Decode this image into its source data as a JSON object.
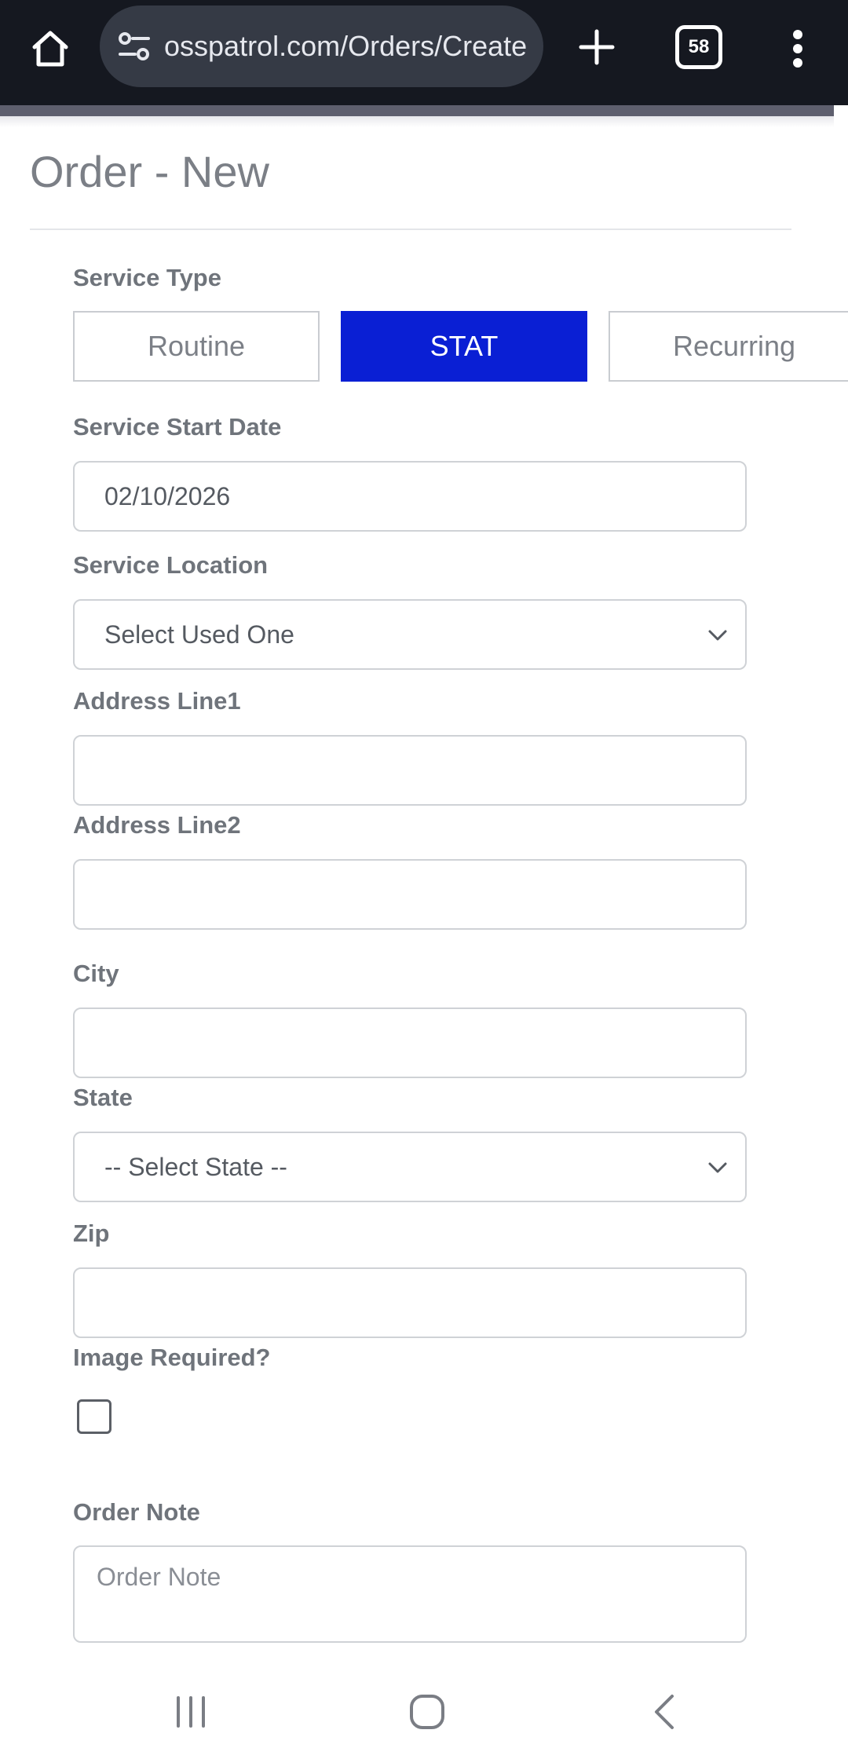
{
  "browser": {
    "url": "osspatrol.com/Orders/Create",
    "tab_count": "58",
    "icons": {
      "home": "home-icon",
      "site_settings": "tune-icon",
      "new_tab": "plus-icon",
      "tabs": "tab-switcher-icon",
      "menu": "more-vertical-icon"
    }
  },
  "page": {
    "title": "Order - New"
  },
  "form": {
    "service_type": {
      "label": "Service Type",
      "options": [
        "Routine",
        "STAT",
        "Recurring"
      ],
      "selected": "STAT"
    },
    "service_start_date": {
      "label": "Service Start Date",
      "value": "02/10/2026"
    },
    "service_location": {
      "label": "Service Location",
      "value": "Select Used One"
    },
    "address_line1": {
      "label": "Address Line1",
      "value": ""
    },
    "address_line2": {
      "label": "Address Line2",
      "value": ""
    },
    "city": {
      "label": "City",
      "value": ""
    },
    "state": {
      "label": "State",
      "value": "-- Select State --"
    },
    "zip": {
      "label": "Zip",
      "value": ""
    },
    "image_required": {
      "label": "Image Required?",
      "checked": false
    },
    "order_note": {
      "label": "Order Note",
      "placeholder": "Order Note",
      "value": ""
    }
  },
  "system_nav": {
    "icons": [
      "recents-icon",
      "home-circle-icon",
      "back-icon"
    ]
  },
  "colors": {
    "browser_bar": "#151820",
    "url_pill": "#353a45",
    "accent_selected": "#0a1fd4",
    "label_text": "#6f747b",
    "input_border": "#cfd2d6"
  }
}
